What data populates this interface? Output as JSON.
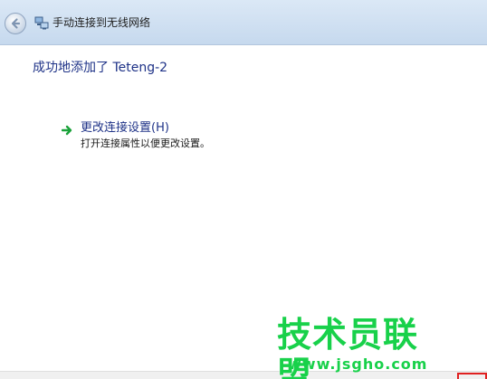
{
  "window": {
    "title": "手动连接到无线网络"
  },
  "icons": {
    "back": "back-arrow-icon",
    "network": "network-icon",
    "link_arrow": "green-arrow-icon"
  },
  "colors": {
    "heading": "#1e3287",
    "link_arrow": "#1aa23a",
    "watermark": "#18d14a"
  },
  "main": {
    "heading": "成功地添加了 Teteng-2",
    "link": {
      "label": "更改连接设置(H)",
      "description": "打开连接属性以便更改设置。"
    }
  },
  "watermark": {
    "text": "技术员联盟",
    "url": "www.jsgho.com"
  }
}
